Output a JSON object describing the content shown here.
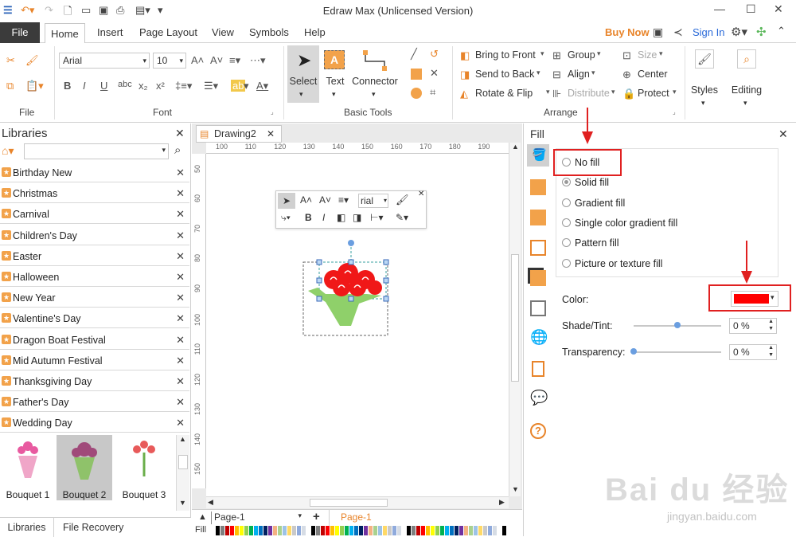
{
  "app": {
    "title": "Edraw Max (Unlicensed Version)",
    "buy_now": "Buy Now",
    "sign_in": "Sign In"
  },
  "menu": {
    "file": "File",
    "tabs": [
      "Home",
      "Insert",
      "Page Layout",
      "View",
      "Symbols",
      "Help"
    ]
  },
  "ribbon": {
    "file_group": "File",
    "font_group": "Font",
    "font_name": "Arial",
    "font_size": "10",
    "basic_tools_group": "Basic Tools",
    "select": "Select",
    "text": "Text",
    "connector": "Connector",
    "arrange_group": "Arrange",
    "bring_to_front": "Bring to Front",
    "send_to_back": "Send to Back",
    "rotate_flip": "Rotate & Flip",
    "group": "Group",
    "align": "Align",
    "distribute": "Distribute",
    "size": "Size",
    "center": "Center",
    "protect": "Protect",
    "styles": "Styles",
    "editing": "Editing"
  },
  "libraries": {
    "title": "Libraries",
    "items": [
      "Birthday New",
      "Christmas",
      "Carnival",
      "Children's Day",
      "Easter",
      "Halloween",
      "New Year",
      "Valentine's Day",
      "Dragon Boat Festival",
      "Mid Autumn Festival",
      "Thanksgiving Day",
      "Father's Day",
      "Wedding Day"
    ],
    "thumbnails": [
      "Bouquet 1",
      "Bouquet 2",
      "Bouquet 3"
    ],
    "bottom_tabs": [
      "Libraries",
      "File Recovery"
    ]
  },
  "canvas": {
    "doc_tab": "Drawing2",
    "ruler_top": [
      "100",
      "110",
      "120",
      "130",
      "140",
      "150",
      "160",
      "170",
      "180",
      "190"
    ],
    "ruler_left": [
      "50",
      "60",
      "70",
      "80",
      "90",
      "100",
      "110",
      "120",
      "130",
      "140",
      "150"
    ],
    "float_font": "rial",
    "page_select": "Page-1",
    "page_tab": "Page-1",
    "fill_label": "Fill"
  },
  "fill_panel": {
    "title": "Fill",
    "options": [
      "No fill",
      "Solid fill",
      "Gradient fill",
      "Single color gradient fill",
      "Pattern fill",
      "Picture or texture fill"
    ],
    "selected_option": "Solid fill",
    "color_label": "Color:",
    "color_value": "#ff0000",
    "shade_label": "Shade/Tint:",
    "shade_value": "0 %",
    "shade_level": 0.5,
    "transparency_label": "Transparency:",
    "transparency_value": "0 %",
    "transparency_level": 0
  },
  "watermark": {
    "text": "Bai du 经验",
    "url": "jingyan.baidu.com"
  }
}
